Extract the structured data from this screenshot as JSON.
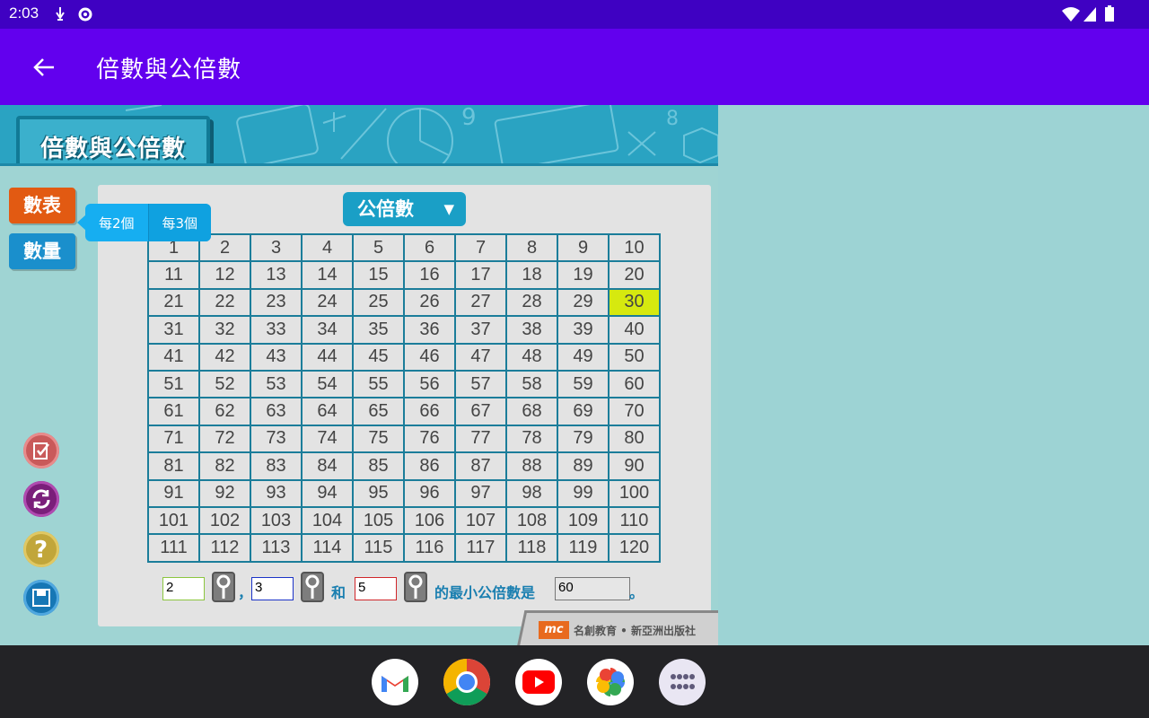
{
  "status_bar": {
    "time": "2:03"
  },
  "app_bar": {
    "title": "倍數與公倍數"
  },
  "banner": {
    "title": "倍數與公倍數"
  },
  "side_menu": {
    "table_label": "數表",
    "count_label": "數量"
  },
  "tooltip": {
    "option1": "每2個",
    "option2": "每3個"
  },
  "mode_dropdown": {
    "label": "公倍數"
  },
  "grid": {
    "rows": [
      [
        "1",
        "2",
        "3",
        "4",
        "5",
        "6",
        "7",
        "8",
        "9",
        "10"
      ],
      [
        "11",
        "12",
        "13",
        "14",
        "15",
        "16",
        "17",
        "18",
        "19",
        "20"
      ],
      [
        "21",
        "22",
        "23",
        "24",
        "25",
        "26",
        "27",
        "28",
        "29",
        "30"
      ],
      [
        "31",
        "32",
        "33",
        "34",
        "35",
        "36",
        "37",
        "38",
        "39",
        "40"
      ],
      [
        "41",
        "42",
        "43",
        "44",
        "45",
        "46",
        "47",
        "48",
        "49",
        "50"
      ],
      [
        "51",
        "52",
        "53",
        "54",
        "55",
        "56",
        "57",
        "58",
        "59",
        "60"
      ],
      [
        "61",
        "62",
        "63",
        "64",
        "65",
        "66",
        "67",
        "68",
        "69",
        "70"
      ],
      [
        "71",
        "72",
        "73",
        "74",
        "75",
        "76",
        "77",
        "78",
        "79",
        "80"
      ],
      [
        "81",
        "82",
        "83",
        "84",
        "85",
        "86",
        "87",
        "88",
        "89",
        "90"
      ],
      [
        "91",
        "92",
        "93",
        "94",
        "95",
        "96",
        "97",
        "98",
        "99",
        "100"
      ],
      [
        "101",
        "102",
        "103",
        "104",
        "105",
        "106",
        "107",
        "108",
        "109",
        "110"
      ],
      [
        "111",
        "112",
        "113",
        "114",
        "115",
        "116",
        "117",
        "118",
        "119",
        "120"
      ]
    ],
    "highlighted": [
      "30"
    ],
    "highlight_color": "#d6e90f"
  },
  "calc": {
    "value1": "2",
    "value2": "3",
    "value3": "5",
    "comma": "，",
    "and": "和",
    "result_label": "的最小公倍數是",
    "result": "60",
    "period": "。"
  },
  "publisher": {
    "logo": "mc",
    "text": "名創教育 • 新亞洲出版社"
  },
  "colors": {
    "status_bar": "#3f01c2",
    "app_bar": "#6200ee",
    "accent_orange": "#e25a12",
    "accent_blue": "#1a8fcc",
    "grid_border": "#1b7d9a"
  },
  "icons": {
    "back": "arrow-left-icon",
    "side_tools": [
      "checklist-icon",
      "refresh-icon",
      "help-icon",
      "save-icon"
    ],
    "dock": [
      "gmail-icon",
      "chrome-icon",
      "youtube-icon",
      "photos-icon",
      "app-drawer-icon"
    ]
  }
}
